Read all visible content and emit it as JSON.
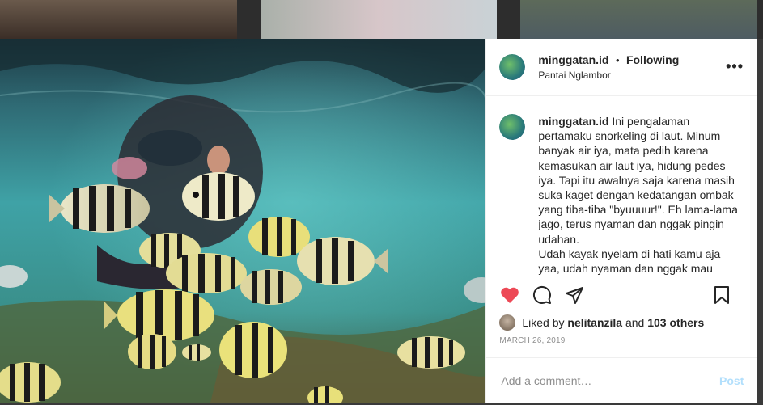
{
  "post": {
    "username": "minggatan.id",
    "separator": "•",
    "follow_status": "Following",
    "location": "Pantai Nglambor",
    "more_label": "•••",
    "caption_lines": [
      "Ini pengalaman pertamaku snorkeling di laut. Minum banyak air iya, mata pedih karena kemasukan air laut iya, hidung pedes iya. Tapi itu awalnya saja karena masih suka kaget dengan kedatangan ombak yang tiba-tiba \"byuuuur!\". Eh lama-lama jago, terus nyaman dan nggak pingin udahan.",
      "Udah kayak nyelam di hati kamu aja yaa, udah nyaman dan nggak mau"
    ],
    "likes": {
      "prefix": "Liked by",
      "first_liker": "nelitanzila",
      "and_text": "and",
      "others": "103 others"
    },
    "date": "MARCH 26, 2019",
    "comment_placeholder": "Add a comment…",
    "post_button": "Post"
  },
  "icons": {
    "like": "heart-icon",
    "comment": "comment-icon",
    "share": "send-icon",
    "save": "bookmark-icon"
  },
  "colors": {
    "like_red": "#ed4956",
    "post_disabled": "#b2dffc",
    "meta_gray": "#8e8e8e"
  }
}
